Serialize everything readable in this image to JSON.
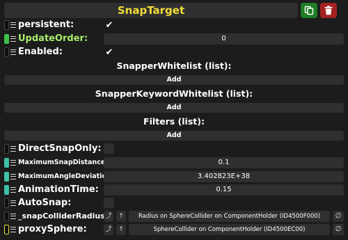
{
  "header": {
    "title": "SnapTarget",
    "duplicate_icon": "duplicate-icon",
    "delete_icon": "trash-icon",
    "title_color": "#f2dc39",
    "duplicate_color": "#1f7d25",
    "delete_color": "#a32222"
  },
  "fields": {
    "persistent": {
      "label": "persistent:",
      "checked": true,
      "check_glyph": "✔"
    },
    "update_order": {
      "label": "UpdateOrder:",
      "value": "0"
    },
    "enabled": {
      "label": "Enabled:",
      "checked": true,
      "check_glyph": "✔"
    },
    "direct_snap_only": {
      "label": "DirectSnapOnly:",
      "checked": false
    },
    "maximum_snap_distance": {
      "label": "MaximumSnapDistance:",
      "value": "0.1"
    },
    "maximum_angle_deviation": {
      "label": "MaximumAngleDeviation:",
      "value": "3.402823E+38"
    },
    "animation_time": {
      "label": "AnimationTime:",
      "value": "0.15"
    },
    "auto_snap": {
      "label": "AutoSnap:",
      "checked": false
    },
    "snap_collider_radius": {
      "label": "_snapColliderRadius:",
      "btn1": "⤴",
      "btn2": "↑",
      "value": "Radius on SphereCollider on ComponentHolder (ID4500F000)",
      "null_glyph": "∅"
    },
    "proxy_sphere": {
      "label": "proxySphere:",
      "btn1": "⤴",
      "btn2": "↑",
      "value": "SphereCollider on ComponentHolder (ID4500EC00)",
      "null_glyph": "∅"
    }
  },
  "lists": {
    "snapper_whitelist": {
      "title": "SnapperWhitelist (list):",
      "add_label": "Add"
    },
    "snapper_keyword_whitelist": {
      "title": "SnapperKeywordWhitelist (list):",
      "add_label": "Add"
    },
    "filters": {
      "title": "Filters (list):",
      "add_label": "Add"
    }
  },
  "colors": {
    "chip_green": "#3fc24a",
    "chip_teal": "#3ec2a8",
    "chip_yellow": "#e8e23a",
    "label_green": "#a8ee6c"
  }
}
